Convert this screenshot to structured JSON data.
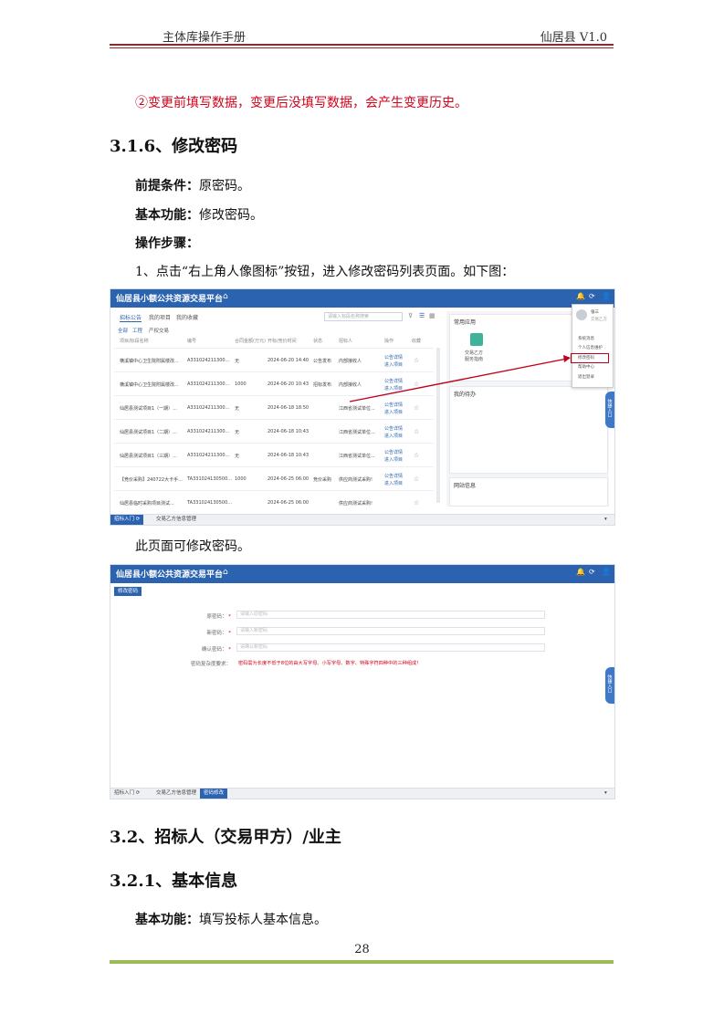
{
  "page_header": {
    "left": "主体库操作手册",
    "right": "仙居县   V1.0"
  },
  "red_note": "②变更前填写数据，变更后没填写数据，会产生变更历史。",
  "section_316": {
    "heading": "3.1.6、修改密码",
    "precondition_label": "前提条件：",
    "precondition_text": "原密码。",
    "function_label": "基本功能：",
    "function_text": "修改密码。",
    "steps_label": "操作步骤：",
    "step1": "1、点击“右上角人像图标”按钮，进入修改密码列表页面。如下图：",
    "caption2": "此页面可修改密码。"
  },
  "section_32": {
    "heading": "3.2、招标人（交易甲方）/业主"
  },
  "section_321": {
    "heading": "3.2.1、基本信息",
    "function_label": "基本功能：",
    "function_text": "填写投标人基本信息。"
  },
  "page_number": "28",
  "screenshot1": {
    "app_title": "仙居县小额公共资源交易平台",
    "tabs": [
      "招标公告",
      "我的项目",
      "我的收藏"
    ],
    "search_placeholder": "请输入标段名称搜索",
    "filter": [
      "全部",
      "工程",
      "产权交易"
    ],
    "columns": [
      "项目/标段名称",
      "编号",
      "合同金额(万元)",
      "开标/竞价时间",
      "状态",
      "招标人",
      "操作",
      "收藏"
    ],
    "rows": [
      {
        "name": "横溪镇中心卫生院附属楼改...",
        "code": "A331024211300...",
        "amount": "无",
        "time": "2024-06-20 14:40",
        "status": "公告发布",
        "owner": "内部接收人",
        "action": "公告详情"
      },
      {
        "name": "横溪镇中心卫生院附属楼改...",
        "code": "A331024211300...",
        "amount": "1000",
        "time": "2024-06-20 10:43",
        "status": "招标发布",
        "owner": "内部接收人",
        "action": "公告详情"
      },
      {
        "name": "仙居县测试项目1（一期）...",
        "code": "A331024211300...",
        "amount": "无",
        "time": "2024-06-18 18:50",
        "status": "",
        "owner": "江西省测试单位...",
        "action": "公告详情"
      },
      {
        "name": "仙居县测试项目1（二期）...",
        "code": "A331024211300...",
        "amount": "无",
        "time": "2024-06-18 10:43",
        "status": "",
        "owner": "江西省测试单位...",
        "action": "公告详情"
      },
      {
        "name": "仙居县测试项目1（三期）...",
        "code": "A331024211300...",
        "amount": "无",
        "time": "2024-06-18 10:43",
        "status": "",
        "owner": "江西省测试单位...",
        "action": "公告详情"
      },
      {
        "name": "【竞价采购】240722大卡手...",
        "code": "TA331024130500...",
        "amount": "1000",
        "time": "2024-06-25 06:00",
        "status": "竞价采购",
        "owner": "供应商测试采购!",
        "action": "公告详情"
      },
      {
        "name": "仙居县临时采购项目测试...",
        "code": "TA331024130500...",
        "amount": "",
        "time": "2024-06-25 06:00",
        "status": "",
        "owner": "供应商测试采购!",
        "action": ""
      }
    ],
    "row_second_action": "进入项目",
    "side_panels": [
      "常用应用",
      "我的待办",
      "网站信息"
    ],
    "app_tile_label": "交易乙方\n服务指南",
    "user_menu": {
      "name": "张三",
      "role": "交易乙方",
      "items": [
        "系统消息",
        "个人信息维护",
        "修改密码",
        "帮助中心",
        "退出登录"
      ]
    },
    "bottom_tabs": [
      "招标入门 ⟳",
      "交易乙方信息管理"
    ],
    "float_button": "快捷入口"
  },
  "screenshot2": {
    "app_title": "仙居县小额公共资源交易平台",
    "action_button": "修改密码",
    "fields": [
      {
        "label": "原密码：",
        "placeholder": "请输入原密码"
      },
      {
        "label": "新密码：",
        "placeholder": "请输入新密码"
      },
      {
        "label": "确认密码：",
        "placeholder": "请确认新密码"
      }
    ],
    "rule_label": "密码复杂度要求：",
    "rule_text": "密码需为长度不低于8位的由大写字母、小写字母、数字、特殊字符四种中的三种组成！",
    "bottom_tabs": [
      "招标入门 ⟳",
      "交易乙方信息管理",
      "密码修改"
    ],
    "float_button": "快捷入口"
  },
  "colors": {
    "accent_blue": "#2b63b0",
    "header_rule": "#8a2b2b",
    "footer_rule": "#9bbb59",
    "note_red": "#d0021b"
  }
}
